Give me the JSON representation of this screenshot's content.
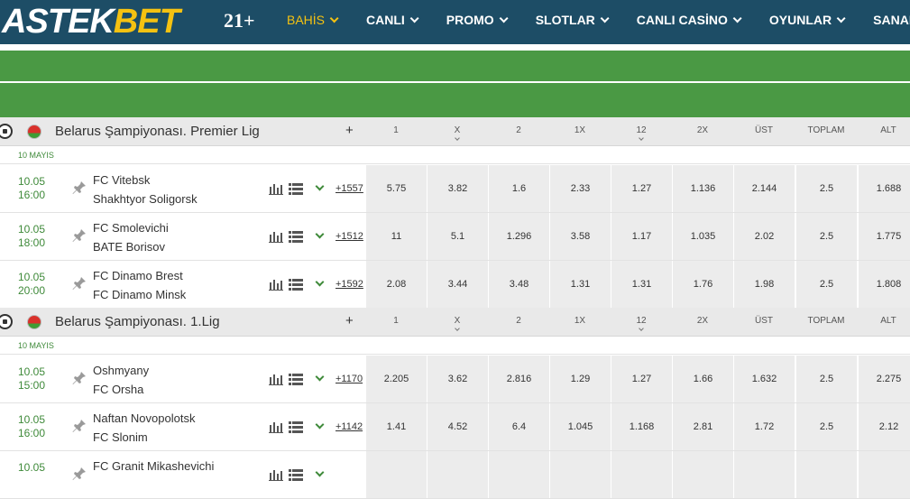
{
  "header": {
    "logo_part1": "ASTEK",
    "logo_part2": "BET",
    "plus21": "21+",
    "nav": [
      {
        "label": "BAHİS",
        "active": true
      },
      {
        "label": "CANLI"
      },
      {
        "label": "PROMO"
      },
      {
        "label": "SLOTLAR"
      },
      {
        "label": "CANLI CASİNO"
      },
      {
        "label": "OYUNLAR"
      },
      {
        "label": "SANAL SPOR"
      }
    ]
  },
  "columns": [
    "1",
    "X",
    "2",
    "1X",
    "12",
    "2X",
    "ÜST",
    "TOPLAM",
    "ALT"
  ],
  "leagues": [
    {
      "name": "Belarus Şampiyonası. Premier Lig",
      "plus": "+",
      "date_label": "10 MAYIS",
      "matches": [
        {
          "date": "10.05",
          "time": "16:00",
          "home": "FC Vitebsk",
          "away": "Shakhtyor Soligorsk",
          "more": "+1557",
          "odds": [
            "5.75",
            "3.82",
            "1.6",
            "2.33",
            "1.27",
            "1.136",
            "2.144",
            "2.5",
            "1.688"
          ]
        },
        {
          "date": "10.05",
          "time": "18:00",
          "home": "FC Smolevichi",
          "away": "BATE Borisov",
          "more": "+1512",
          "odds": [
            "11",
            "5.1",
            "1.296",
            "3.58",
            "1.17",
            "1.035",
            "2.02",
            "2.5",
            "1.775"
          ]
        },
        {
          "date": "10.05",
          "time": "20:00",
          "home": "FC Dinamo Brest",
          "away": "FC Dinamo Minsk",
          "more": "+1592",
          "odds": [
            "2.08",
            "3.44",
            "3.48",
            "1.31",
            "1.31",
            "1.76",
            "1.98",
            "2.5",
            "1.808"
          ]
        }
      ]
    },
    {
      "name": "Belarus Şampiyonası. 1.Lig",
      "plus": "+",
      "date_label": "10 MAYIS",
      "matches": [
        {
          "date": "10.05",
          "time": "15:00",
          "home": "Oshmyany",
          "away": "FC Orsha",
          "more": "+1170",
          "odds": [
            "2.205",
            "3.62",
            "2.816",
            "1.29",
            "1.27",
            "1.66",
            "1.632",
            "2.5",
            "2.275"
          ]
        },
        {
          "date": "10.05",
          "time": "16:00",
          "home": "Naftan Novopolotsk",
          "away": "FC Slonim",
          "more": "+1142",
          "odds": [
            "1.41",
            "4.52",
            "6.4",
            "1.045",
            "1.168",
            "2.81",
            "1.72",
            "2.5",
            "2.12"
          ]
        },
        {
          "date": "10.05",
          "time": "",
          "home": "FC Granit Mikashevichi",
          "away": "",
          "more": "",
          "odds": [
            "",
            "",
            "",
            "",
            "",
            "",
            "",
            "",
            ""
          ]
        }
      ]
    }
  ]
}
